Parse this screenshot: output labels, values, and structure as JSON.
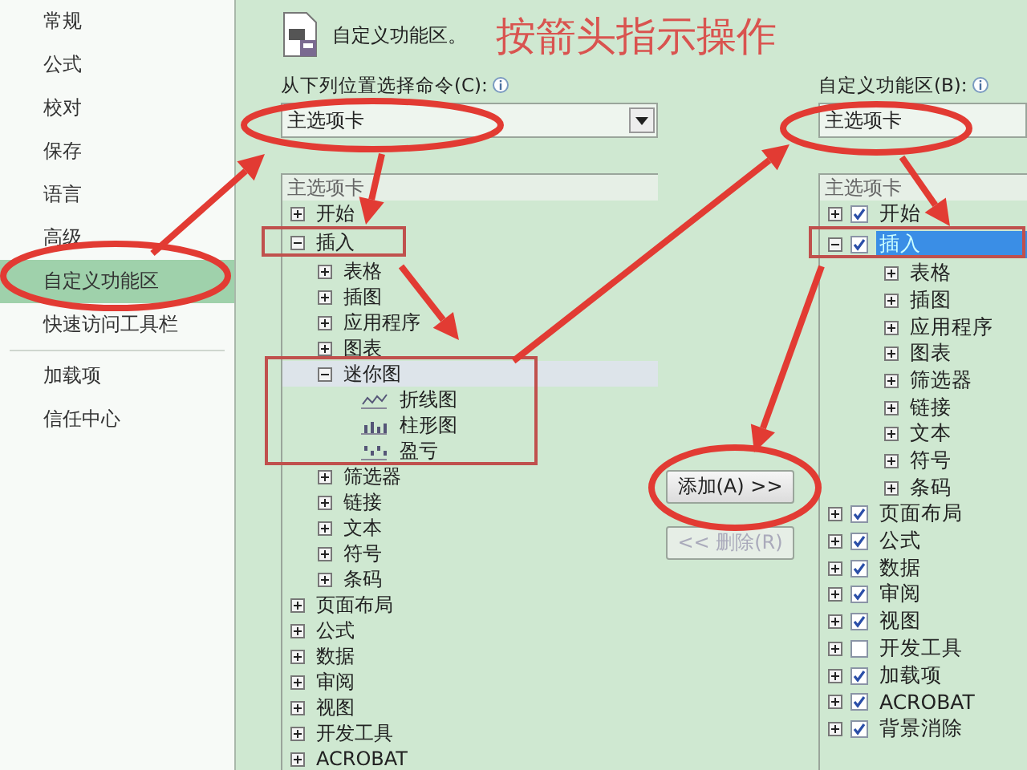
{
  "sidebar": {
    "items": [
      {
        "label": "常规",
        "selected": false
      },
      {
        "label": "公式",
        "selected": false
      },
      {
        "label": "校对",
        "selected": false
      },
      {
        "label": "保存",
        "selected": false
      },
      {
        "label": "语言",
        "selected": false
      },
      {
        "label": "高级",
        "selected": false
      },
      {
        "label": "自定义功能区",
        "selected": true
      },
      {
        "label": "快速访问工具栏",
        "selected": false
      },
      {
        "label": "加载项",
        "selected": false
      },
      {
        "label": "信任中心",
        "selected": false
      }
    ]
  },
  "header": {
    "title": "自定义功能区。",
    "annotation": "按箭头指示操作"
  },
  "left": {
    "label": "从下列位置选择命令(C):",
    "dropdown": "主选项卡",
    "tree_header": "主选项卡",
    "tree": [
      {
        "label": "开始",
        "expanded": false,
        "selected": false
      },
      {
        "label": "插入",
        "expanded": true,
        "selected": false,
        "children": [
          {
            "label": "表格",
            "expanded": false,
            "selected": false
          },
          {
            "label": "插图",
            "expanded": false,
            "selected": false
          },
          {
            "label": "应用程序",
            "expanded": false,
            "selected": false
          },
          {
            "label": "图表",
            "expanded": false,
            "selected": false
          },
          {
            "label": "迷你图",
            "expanded": true,
            "selected": true,
            "children": [
              {
                "label": "折线图",
                "kind": "line",
                "selected": false
              },
              {
                "label": "柱形图",
                "kind": "column",
                "selected": false
              },
              {
                "label": "盈亏",
                "kind": "win-loss",
                "selected": false
              }
            ]
          },
          {
            "label": "筛选器",
            "expanded": false,
            "selected": false
          },
          {
            "label": "链接",
            "expanded": false,
            "selected": false
          },
          {
            "label": "文本",
            "expanded": false,
            "selected": false
          },
          {
            "label": "符号",
            "expanded": false,
            "selected": false
          },
          {
            "label": "条码",
            "expanded": false,
            "selected": false
          }
        ]
      },
      {
        "label": "页面布局",
        "expanded": false,
        "selected": false
      },
      {
        "label": "公式",
        "expanded": false,
        "selected": false
      },
      {
        "label": "数据",
        "expanded": false,
        "selected": false
      },
      {
        "label": "审阅",
        "expanded": false,
        "selected": false
      },
      {
        "label": "视图",
        "expanded": false,
        "selected": false
      },
      {
        "label": "开发工具",
        "expanded": false,
        "selected": false
      },
      {
        "label": "ACROBAT",
        "expanded": false,
        "selected": false
      }
    ]
  },
  "buttons": [
    {
      "label": "添加(A) >>",
      "disabled": false
    },
    {
      "label": "<< 删除(R)",
      "disabled": true
    }
  ],
  "right": {
    "label": "自定义功能区(B):",
    "dropdown": "主选项卡",
    "tree_header": "主选项卡",
    "tree": [
      {
        "label": "开始",
        "expanded": false,
        "checked": true,
        "selected": false
      },
      {
        "label": "插入",
        "expanded": true,
        "checked": true,
        "selected": true,
        "children": [
          {
            "label": "表格",
            "expanded": false,
            "selected": false
          },
          {
            "label": "插图",
            "expanded": false,
            "selected": false
          },
          {
            "label": "应用程序",
            "expanded": false,
            "selected": false
          },
          {
            "label": "图表",
            "expanded": false,
            "selected": false
          },
          {
            "label": "筛选器",
            "expanded": false,
            "selected": false
          },
          {
            "label": "链接",
            "expanded": false,
            "selected": false
          },
          {
            "label": "文本",
            "expanded": false,
            "selected": false
          },
          {
            "label": "符号",
            "expanded": false,
            "selected": false
          },
          {
            "label": "条码",
            "expanded": false,
            "selected": false
          }
        ]
      },
      {
        "label": "页面布局",
        "expanded": false,
        "checked": true,
        "selected": false
      },
      {
        "label": "公式",
        "expanded": false,
        "checked": true,
        "selected": false
      },
      {
        "label": "数据",
        "expanded": false,
        "checked": true,
        "selected": false
      },
      {
        "label": "审阅",
        "expanded": false,
        "checked": true,
        "selected": false
      },
      {
        "label": "视图",
        "expanded": false,
        "checked": true,
        "selected": false
      },
      {
        "label": "开发工具",
        "expanded": false,
        "checked": false,
        "selected": false
      },
      {
        "label": "加载项",
        "expanded": false,
        "checked": true,
        "selected": false
      },
      {
        "label": "ACROBAT",
        "expanded": false,
        "checked": true,
        "selected": false
      },
      {
        "label": "背景消除",
        "expanded": false,
        "checked": true,
        "selected": false
      }
    ]
  }
}
